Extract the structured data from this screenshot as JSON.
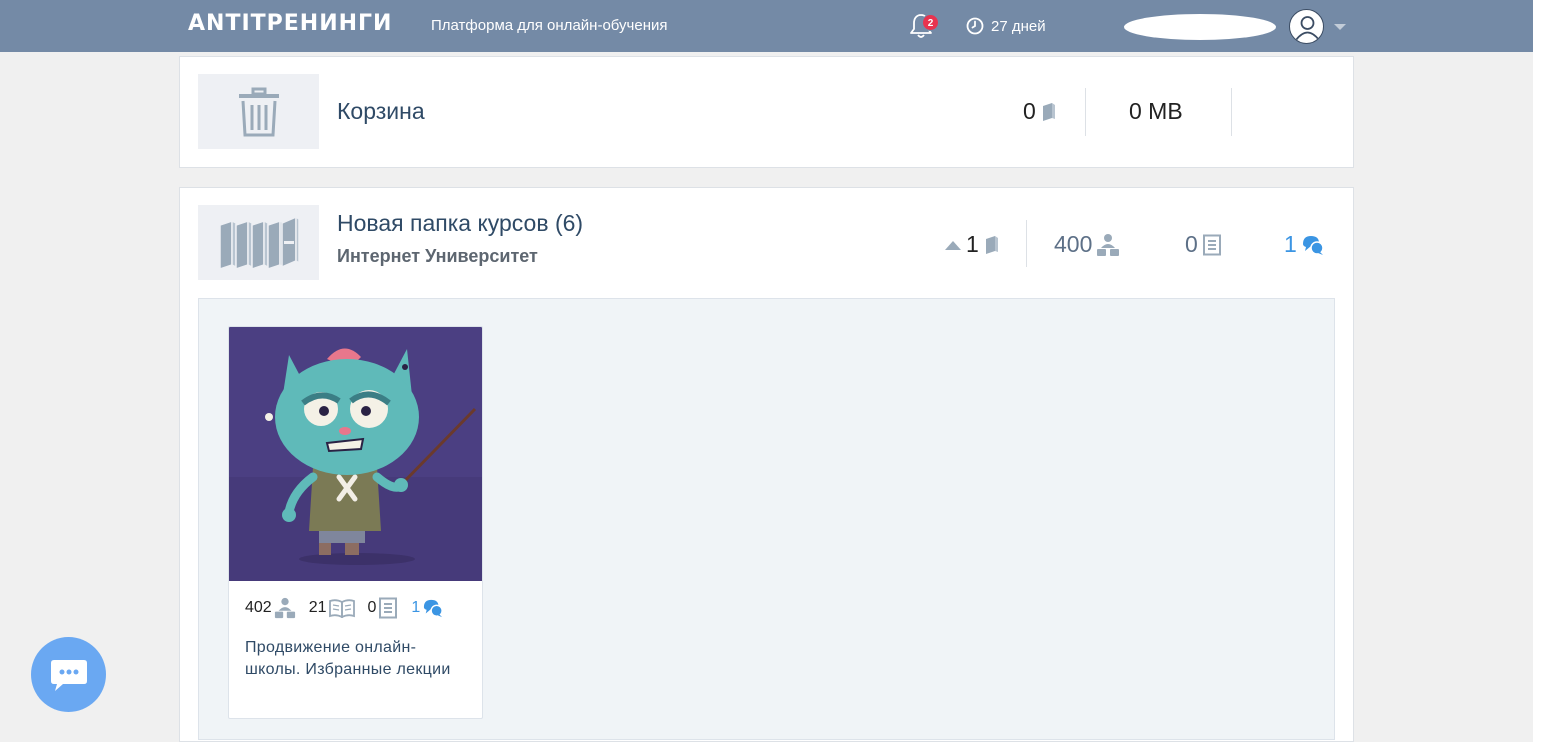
{
  "header": {
    "logo": "ANTITРЕНИНГИ",
    "tagline": "Платформа для онлайн-обучения",
    "notifications_count": "2",
    "days_left": "27 дней"
  },
  "trash": {
    "title": "Корзина",
    "courses_count": "0",
    "size": "0 MB"
  },
  "folder": {
    "title": "Новая папка курсов (6)",
    "owner": "Интернет Университет",
    "courses_count": "1",
    "students_count": "400",
    "tasks_count": "0",
    "chats_count": "1",
    "courses": [
      {
        "students": "402",
        "lessons": "21",
        "tasks": "0",
        "chats": "1",
        "title": "Продвижение онлайн-школы. Избранные лекции"
      }
    ]
  },
  "colors": {
    "topbar": "#748aa6",
    "title": "#2f4a66",
    "icon_gray": "#9aaab9",
    "accent_blue": "#3b95e3",
    "badge_red": "#e8334f",
    "chat_button": "#6aa8f2"
  }
}
